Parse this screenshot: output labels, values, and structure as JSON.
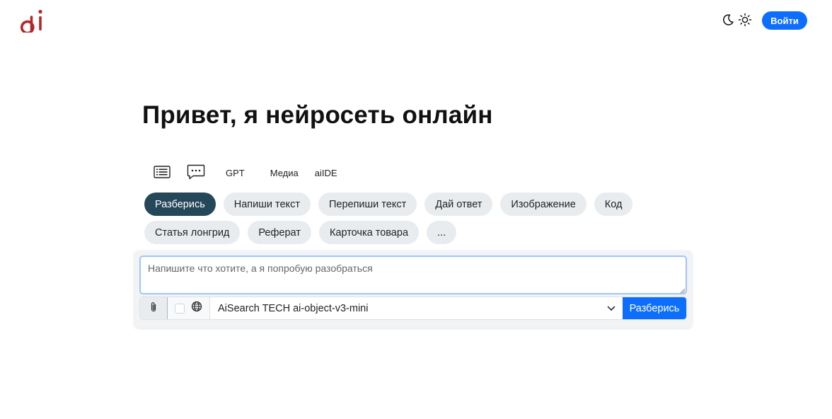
{
  "header": {
    "logo_text": "ai",
    "login_label": "Войти"
  },
  "main": {
    "title": "Привет, я нейросеть онлайн",
    "mode_tabs": [
      {
        "icon": "list-icon"
      },
      {
        "icon": "chat-dots-icon"
      },
      {
        "label": "GPT"
      },
      {
        "label": "Медиа"
      },
      {
        "label": "aiIDE"
      }
    ],
    "chips_row1": [
      "Разберись",
      "Напиши текст",
      "Перепиши текст",
      "Дай ответ",
      "Изображение",
      "Код"
    ],
    "chips_row2": [
      "Статья лонгрид",
      "Реферат",
      "Карточка товара",
      "..."
    ],
    "active_chip": "Разберись"
  },
  "composer": {
    "placeholder": "Напишите что хотите, а я попробую разобраться",
    "value": "",
    "model": "AiSearch TECH ai-object-v3-mini",
    "submit_label": "Разберись",
    "web_search_checked": false
  },
  "colors": {
    "brand": "#b3262a",
    "primary": "#0d6efd",
    "active_chip": "#25475a",
    "chip_bg": "#e9ecef"
  }
}
